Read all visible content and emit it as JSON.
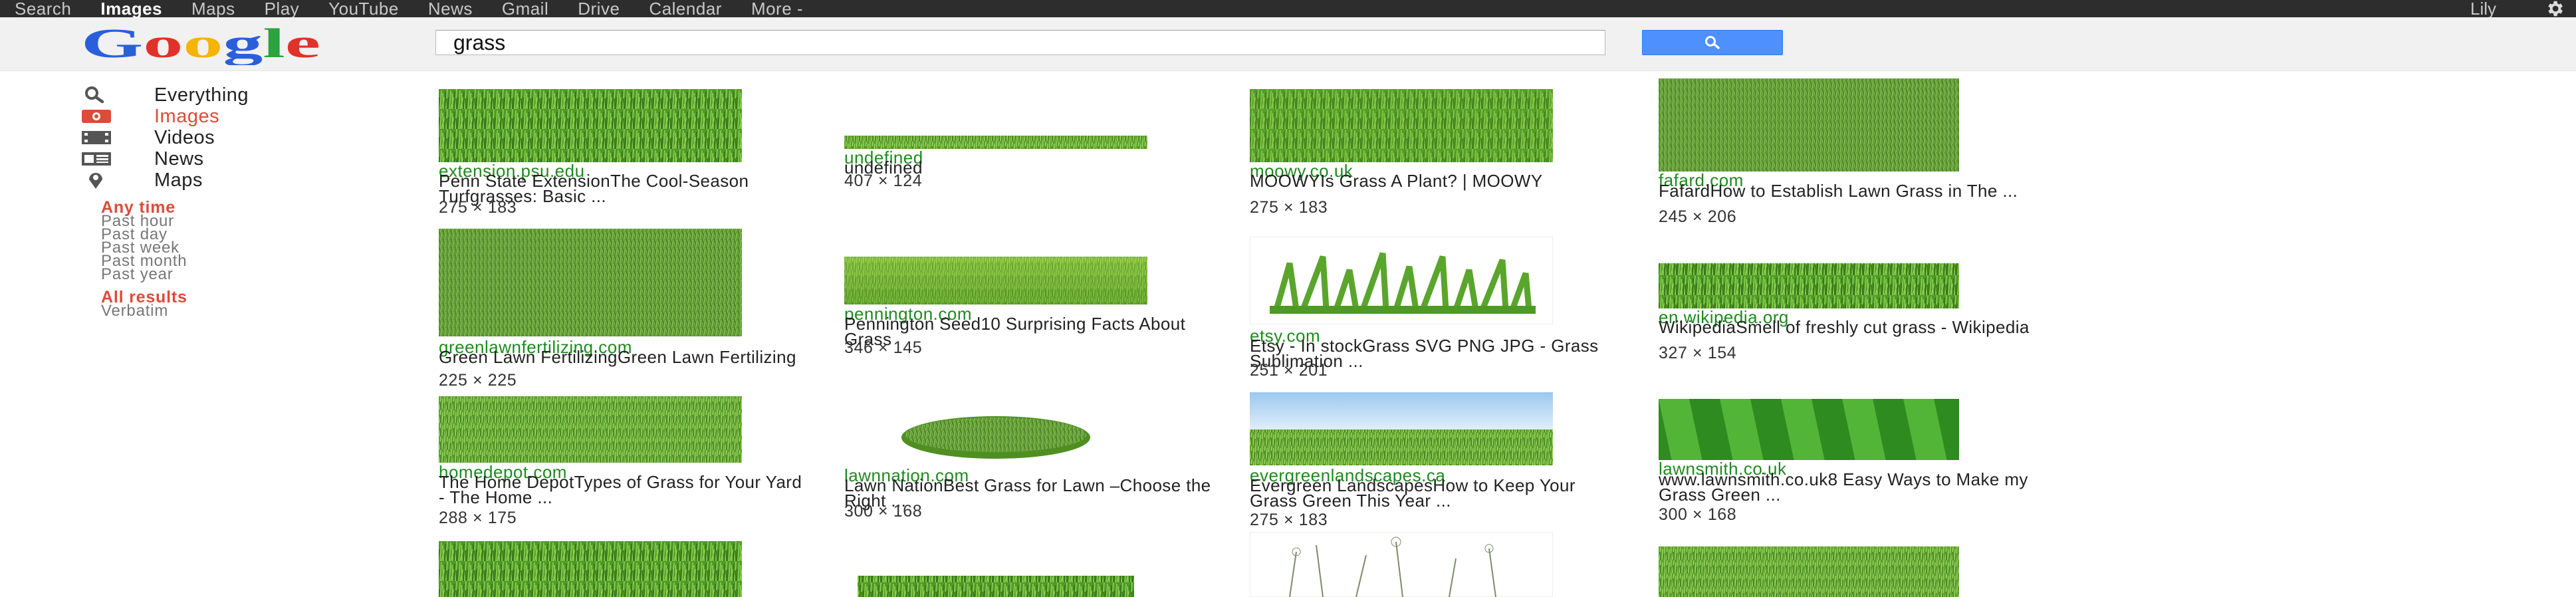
{
  "topbar": {
    "nav": [
      "Search",
      "Images",
      "Maps",
      "Play",
      "YouTube",
      "News",
      "Gmail",
      "Drive",
      "Calendar",
      "More -"
    ],
    "active_index": 1,
    "user": "Lily"
  },
  "header": {
    "logo_text": "Google",
    "query": "grass"
  },
  "sidebar": {
    "items": [
      {
        "label": "Everything",
        "icon": "search-icon"
      },
      {
        "label": "Images",
        "icon": "camera-icon"
      },
      {
        "label": "Videos",
        "icon": "film-icon"
      },
      {
        "label": "News",
        "icon": "newspaper-icon"
      },
      {
        "label": "Maps",
        "icon": "map-pin-icon"
      }
    ],
    "active_index": 1,
    "time_filter": {
      "heading": "Any time",
      "options": [
        "Past hour",
        "Past day",
        "Past week",
        "Past month",
        "Past year"
      ]
    },
    "results_filter": {
      "heading": "All results",
      "options": [
        "Verbatim"
      ]
    }
  },
  "results": [
    {
      "source": "extension.psu.edu",
      "title": "Penn State ExtensionThe Cool-Season Turfgrasses: Basic ...",
      "dims": "275 × 183"
    },
    {
      "source": "undefined",
      "title": "undefined",
      "dims": "407 × 124"
    },
    {
      "source": "moowy.co.uk",
      "title": "MOOWYIs Grass A Plant? | MOOWY",
      "dims": "275 × 183"
    },
    {
      "source": "fafard.com",
      "title": "FafardHow to Establish Lawn Grass in The ...",
      "dims": "245 × 206"
    },
    {
      "source": "greenlawnfertilizing.com",
      "title": "Green Lawn FertilizingGreen Lawn Fertilizing",
      "dims": "225 × 225"
    },
    {
      "source": "pennington.com",
      "title": "Pennington Seed10 Surprising Facts About Grass",
      "dims": "346 × 145"
    },
    {
      "source": "etsy.com",
      "title": "Etsy - In stockGrass SVG PNG JPG - Grass Sublimation ...",
      "dims": "251 × 201"
    },
    {
      "source": "en.wikipedia.org",
      "title": "WikipediaSmell of freshly cut grass - Wikipedia",
      "dims": "327 × 154"
    },
    {
      "source": "homedepot.com",
      "title": "The Home DepotTypes of Grass for Your Yard - The Home ...",
      "dims": "288 × 175"
    },
    {
      "source": "lawnnation.com",
      "title": "Lawn NationBest Grass for Lawn –Choose the Right ...",
      "dims": "300 × 168"
    },
    {
      "source": "evergreenlandscapes.ca",
      "title": "Evergreen LandscapesHow to Keep Your Grass Green This Year ...",
      "dims": "275 × 183"
    },
    {
      "source": "lawnsmith.co.uk",
      "title": "www.lawnsmith.co.uk8 Easy Ways to Make my Grass Green ...",
      "dims": "300 × 168"
    }
  ],
  "colors": {
    "active_red": "#dd4b39",
    "source_green": "#1e8a1e",
    "search_blue": "#4d90fe",
    "topbar_bg": "#2d2d2d"
  }
}
